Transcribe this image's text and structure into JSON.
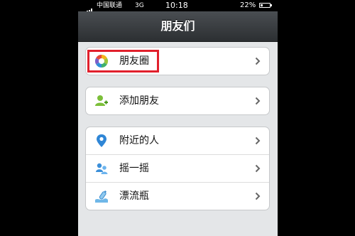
{
  "status_bar": {
    "carrier": "中国联通",
    "network": "3G",
    "time": "10:18",
    "battery_text": "22%",
    "battery_level": 0.22
  },
  "nav": {
    "title": "朋友们"
  },
  "groups": [
    {
      "items": [
        {
          "label": "朋友圈",
          "icon": "moments-icon"
        }
      ]
    },
    {
      "items": [
        {
          "label": "添加朋友",
          "icon": "add-friend-icon"
        }
      ]
    },
    {
      "items": [
        {
          "label": "附近的人",
          "icon": "location-pin-icon"
        },
        {
          "label": "摇一摇",
          "icon": "shake-icon"
        },
        {
          "label": "漂流瓶",
          "icon": "drift-bottle-icon"
        }
      ]
    }
  ],
  "colors": {
    "highlight": "#e1202c",
    "nav_bar": "#3a3e42",
    "background": "#e4e6e8"
  }
}
